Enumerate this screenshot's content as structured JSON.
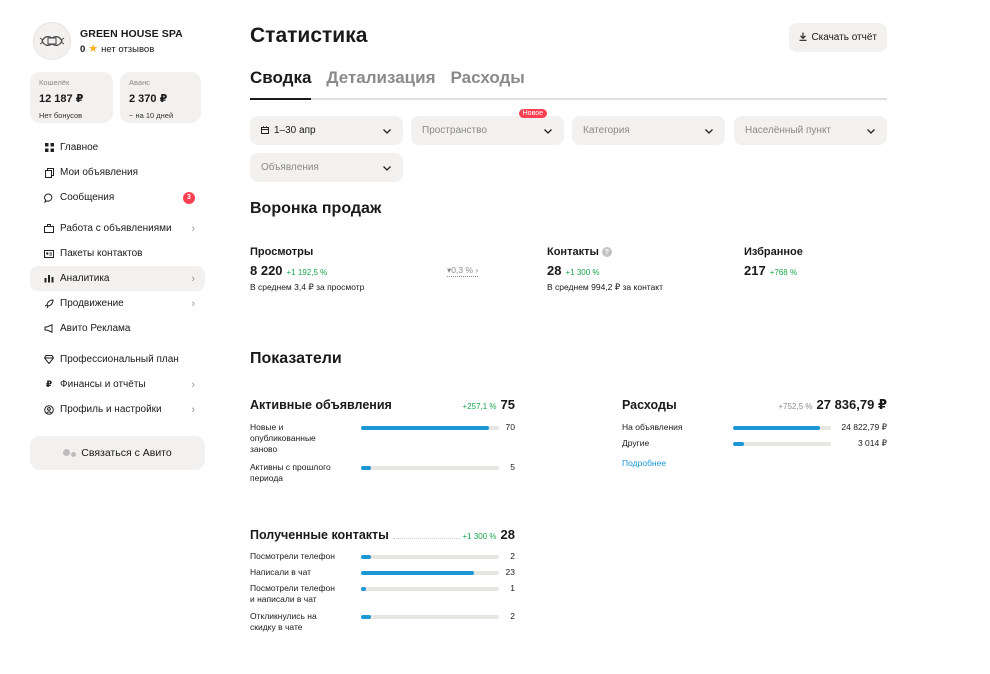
{
  "profile": {
    "name": "GREEN HOUSE SPA",
    "rating_value": "0",
    "rating_text": "нет отзывов"
  },
  "wallets": [
    {
      "label": "Кошелёк",
      "value": "12 187 ₽",
      "sub": "Нет бонусов"
    },
    {
      "label": "Аванс",
      "value": "2 370 ₽",
      "sub": "~ на 10 дней"
    }
  ],
  "nav": {
    "items": [
      {
        "label": "Главное",
        "icon": "grid-icon"
      },
      {
        "label": "Мои объявления",
        "icon": "copy-icon"
      },
      {
        "label": "Сообщения",
        "icon": "chat-icon",
        "badge": "3"
      },
      {
        "label": "Работа с объявлениями",
        "icon": "briefcase-icon"
      },
      {
        "label": "Пакеты контактов",
        "icon": "contact-card-icon"
      },
      {
        "label": "Аналитика",
        "icon": "bar-chart-icon"
      },
      {
        "label": "Продвижение",
        "icon": "rocket-icon"
      },
      {
        "label": "Авито Реклама",
        "icon": "megaphone-icon"
      },
      {
        "label": "Профессиональный план",
        "icon": "diamond-icon"
      },
      {
        "label": "Финансы и отчёты",
        "icon": "ruble-icon"
      },
      {
        "label": "Профиль и настройки",
        "icon": "user-circle-icon"
      }
    ],
    "contact_button": "Связаться с Авито"
  },
  "header": {
    "title": "Статистика",
    "download_label": "Скачать отчёт"
  },
  "tabs": [
    "Сводка",
    "Детализация",
    "Расходы"
  ],
  "filters": {
    "date": "1–30 апр",
    "space": "Пространство",
    "space_badge": "Новое",
    "category": "Категория",
    "city": "Населённый пункт",
    "ads": "Объявления"
  },
  "funnel": {
    "title": "Воронка продаж",
    "views": {
      "label": "Просмотры",
      "value": "8 220",
      "delta": "+1 192,5 %",
      "sub": "В среднем 3,4 ₽ за просмотр"
    },
    "conversion": "0,3 %",
    "contacts": {
      "label": "Контакты",
      "value": "28",
      "delta": "+1 300 %",
      "sub": "В среднем 994,2 ₽ за контакт"
    },
    "favorites": {
      "label": "Избранное",
      "value": "217",
      "delta": "+768 %"
    }
  },
  "indicators": {
    "title": "Показатели",
    "active_ads": {
      "title": "Активные объявления",
      "delta": "+257,1 %",
      "total": "75",
      "rows": [
        {
          "label": "Новые и опубликованные заново",
          "value": "70",
          "fill": 0.93
        },
        {
          "label": "Активны с прошлого периода",
          "value": "5",
          "fill": 0.07
        }
      ]
    },
    "expenses": {
      "title": "Расходы",
      "delta": "+752,5 %",
      "total": "27 836,79 ₽",
      "rows": [
        {
          "label": "На объявления",
          "value": "24 822,79 ₽",
          "fill": 0.89
        },
        {
          "label": "Другие",
          "value": "3 014 ₽",
          "fill": 0.11
        }
      ],
      "more": "Подробнее"
    },
    "received_contacts": {
      "title": "Полученные контакты",
      "delta": "+1 300 %",
      "total": "28",
      "rows": [
        {
          "label": "Посмотрели телефон",
          "value": "2",
          "fill": 0.07
        },
        {
          "label": "Написали в чат",
          "value": "23",
          "fill": 0.82
        },
        {
          "label": "Посмотрели телефон и написали в чат",
          "value": "1",
          "fill": 0.035
        },
        {
          "label": "Откликнулись на скидку в чате",
          "value": "2",
          "fill": 0.07
        }
      ]
    }
  },
  "colors": {
    "accent_blue": "#1b97d4",
    "positive_green": "#1aa64b",
    "badge_red": "#ff4053",
    "surface_grey": "#f2f1ef"
  }
}
